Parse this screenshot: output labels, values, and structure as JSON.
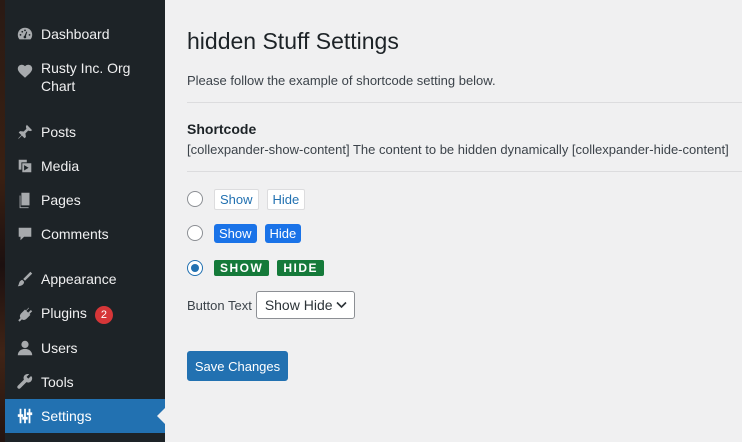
{
  "sidebar": {
    "items": [
      {
        "label": "Dashboard",
        "icon": "dashboard-icon"
      },
      {
        "label": "Rusty Inc. Org Chart",
        "icon": "heart-icon"
      },
      {
        "label": "Posts",
        "icon": "pushpin-icon"
      },
      {
        "label": "Media",
        "icon": "media-icon"
      },
      {
        "label": "Pages",
        "icon": "pages-icon"
      },
      {
        "label": "Comments",
        "icon": "comment-icon"
      },
      {
        "label": "Appearance",
        "icon": "paintbrush-icon"
      },
      {
        "label": "Plugins",
        "icon": "plugin-icon",
        "badge": "2"
      },
      {
        "label": "Users",
        "icon": "user-icon"
      },
      {
        "label": "Tools",
        "icon": "wrench-icon"
      },
      {
        "label": "Settings",
        "icon": "settings-sliders-icon",
        "current": true
      }
    ],
    "badge_color": "#d63638",
    "current_color": "#2271b1"
  },
  "main": {
    "title": "hidden Stuff Settings",
    "intro": "Please follow the example of shortcode setting below.",
    "shortcode_heading": "Shortcode",
    "shortcode_text": "[collexpander-show-content] The content to be hidden dynamically [collexpander-hide-content]",
    "options": [
      {
        "show": "Show",
        "hide": "Hide",
        "style": "outline",
        "checked": false
      },
      {
        "show": "Show",
        "hide": "Hide",
        "style": "blue",
        "checked": false
      },
      {
        "show": "SHOW",
        "hide": "HIDE",
        "style": "green",
        "checked": true
      }
    ],
    "button_text_label": "Button Text",
    "button_text_value": "Show Hide",
    "save_label": "Save Changes"
  }
}
